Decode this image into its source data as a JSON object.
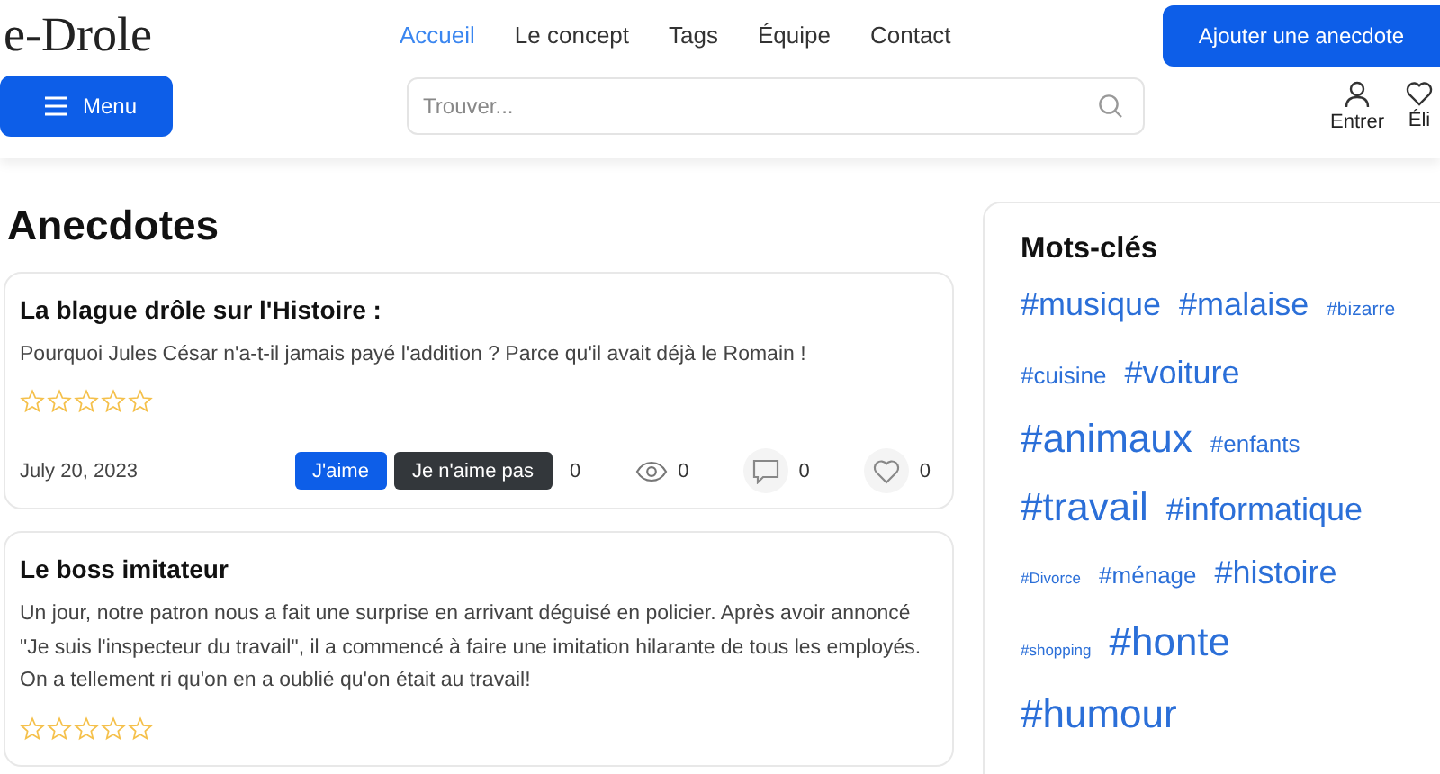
{
  "header": {
    "logo": "e-Drole",
    "nav": [
      {
        "label": "Accueil",
        "selected": true
      },
      {
        "label": "Le concept",
        "selected": false
      },
      {
        "label": "Tags",
        "selected": false
      },
      {
        "label": "Équipe",
        "selected": false
      },
      {
        "label": "Contact",
        "selected": false
      }
    ],
    "add_button": "Ajouter une anecdote",
    "menu_button": "Menu",
    "search": {
      "placeholder": "Trouver..."
    },
    "actions": [
      {
        "kind": "user",
        "label": "Entrer"
      },
      {
        "kind": "heart",
        "label": "Éli"
      }
    ]
  },
  "main": {
    "title": "Anecdotes",
    "posts": [
      {
        "title": "La blague drôle sur l'Histoire :",
        "body": "Pourquoi Jules César n'a-t-il jamais payé l'addition ? Parce qu'il avait déjà le Romain !",
        "stars": 0,
        "date": "July 20, 2023",
        "like": "J'aime",
        "dislike": "Je n'aime pas",
        "votes": "0",
        "views": "0",
        "comments": "0",
        "favorites": "0"
      },
      {
        "title": "Le boss imitateur",
        "body": "Un jour, notre patron nous a fait une surprise en arrivant déguisé en policier. Après avoir annoncé \"Je suis l'inspecteur du travail\", il a commencé à faire une imitation hilarante de tous les employés. On a tellement ri qu'on en a oublié qu'on était au travail!",
        "stars": 0
      }
    ]
  },
  "sidebar": {
    "title": "Mots-clés",
    "tags": [
      {
        "label": "#musique",
        "kind": "large"
      },
      {
        "label": "#malaise",
        "kind": "large"
      },
      {
        "label": "#bizarre",
        "kind": "small"
      },
      {
        "label": "#cuisine",
        "kind": "medium"
      },
      {
        "label": "#voiture",
        "kind": "large"
      },
      {
        "label": "#animaux",
        "kind": "huge"
      },
      {
        "label": "#enfants",
        "kind": "medium"
      },
      {
        "label": "#travail",
        "kind": "huge"
      },
      {
        "label": "#informatique",
        "kind": "large"
      },
      {
        "label": "#Divorce",
        "kind": "tiny"
      },
      {
        "label": "#ménage",
        "kind": "medium"
      },
      {
        "label": "#histoire",
        "kind": "large"
      },
      {
        "label": "#shopping",
        "kind": "tiny"
      },
      {
        "label": "#honte",
        "kind": "huge"
      },
      {
        "label": "#humour",
        "kind": "huge"
      }
    ]
  }
}
